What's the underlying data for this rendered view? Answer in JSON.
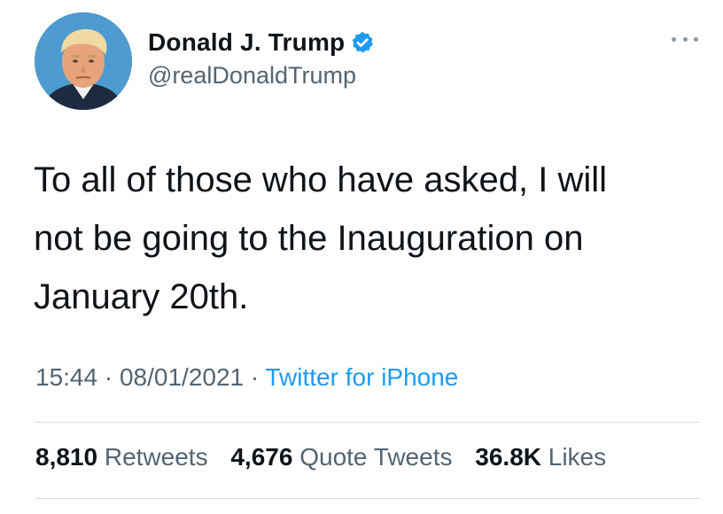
{
  "author": {
    "display_name": "Donald J. Trump",
    "handle": "@realDonaldTrump",
    "verified": true
  },
  "tweet": {
    "text_lines": [
      "To all of those who have asked, I will",
      "not be going to the Inauguration on",
      "January 20th."
    ],
    "time": "15:44",
    "date": "08/01/2021",
    "separator": "·",
    "source": "Twitter for iPhone"
  },
  "stats": {
    "retweets_count": "8,810",
    "retweets_label": "Retweets",
    "quotes_count": "4,676",
    "quotes_label": "Quote Tweets",
    "likes_count": "36.8K",
    "likes_label": "Likes"
  },
  "colors": {
    "text_primary": "#0f1419",
    "text_secondary": "#536471",
    "accent": "#1d9bf0",
    "divider": "#d7dbdc"
  },
  "icons": {
    "verified": "verified-badge-icon",
    "more": "more-options-icon"
  }
}
